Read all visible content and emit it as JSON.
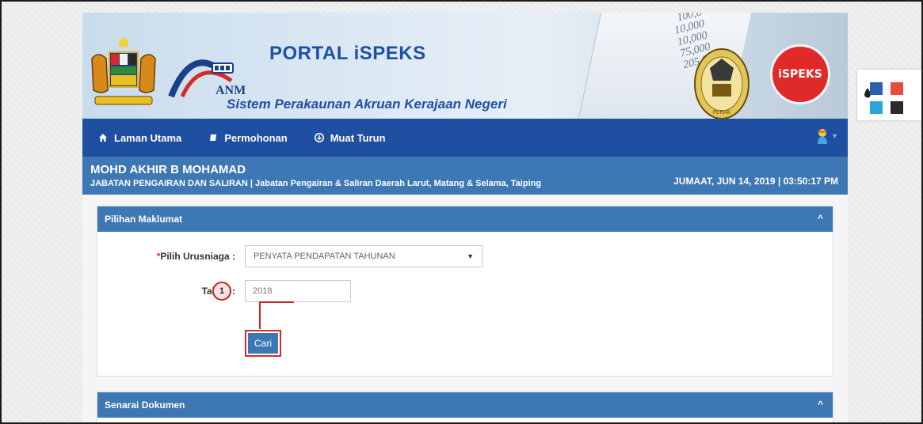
{
  "banner": {
    "portal_title": "PORTAL iSPEKS",
    "org_short": "ANM",
    "subtitle": "Sistem Perakaunan Akruan Kerajaan Negeri",
    "ispeks_badge": "iSPEKS",
    "seal_label": "PERAK",
    "background_numbers": [
      "100,0",
      "10,000",
      "10,000",
      "75,000",
      "205,00"
    ]
  },
  "navbar": {
    "items": [
      {
        "label": "Laman Utama",
        "icon": "home-icon"
      },
      {
        "label": "Permohonan",
        "icon": "book-icon"
      },
      {
        "label": "Muat Turun",
        "icon": "download-icon"
      }
    ],
    "user_icon": "user-avatar-icon"
  },
  "userbar": {
    "name": "MOHD AKHIR B MOHAMAD",
    "department": "JABATAN PENGAIRAN DAN SALIRAN | Jabatan Pengairan & Saliran Daerah Larut, Matang & Selama, Taiping",
    "datetime": "JUMAAT, JUN 14, 2019 | 03:50:17 PM"
  },
  "panel_pilihan": {
    "title": "Pilihan Maklumat",
    "urusniaga_label": "Pilih Urusniaga :",
    "urusniaga_required": "*",
    "urusniaga_value": "PENYATA PENDAPATAN TAHUNAN",
    "tahun_label": "Tahun :",
    "tahun_value": "2018",
    "search_button": "Cari"
  },
  "panel_senarai": {
    "title": "Senarai Dokumen"
  },
  "callout": {
    "number": "1"
  },
  "theme_switcher": {
    "icon": "drop-icon",
    "colors": [
      "#2a5fb0",
      "#e84c3d",
      "#2ba6dc",
      "#2b2b2b"
    ]
  },
  "colors": {
    "primary_blue": "#1e4fa0",
    "header_blue": "#3d78b5",
    "accent_red": "#d42a2a"
  }
}
